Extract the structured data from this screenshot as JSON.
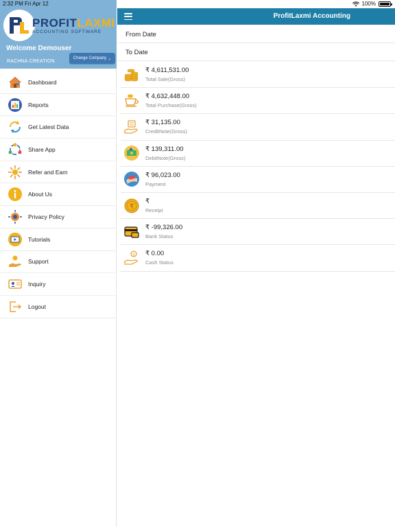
{
  "status_bar": {
    "time": "2:32 PM",
    "date": "Fri Apr 12",
    "battery": "100%"
  },
  "sidebar": {
    "logo": {
      "title_part1": "PROFIT",
      "title_part2": "LAXMI",
      "subtitle": "ACCOUNTING SOFTWARE"
    },
    "welcome": "Welcome Demouser",
    "company": "RACHNA CREATION",
    "change_company": "Change Company",
    "items": [
      {
        "label": "Dashboard",
        "icon": "house-icon"
      },
      {
        "label": "Reports",
        "icon": "reports-icon"
      },
      {
        "label": "Get Latest Data",
        "icon": "refresh-icon"
      },
      {
        "label": "Share App",
        "icon": "share-icon"
      },
      {
        "label": "Refer and Earn",
        "icon": "refer-icon"
      },
      {
        "label": "About Us",
        "icon": "info-icon"
      },
      {
        "label": "Privacy Policy",
        "icon": "privacy-icon"
      },
      {
        "label": "Tutorials",
        "icon": "tutorials-icon"
      },
      {
        "label": "Support",
        "icon": "support-icon"
      },
      {
        "label": "Inquiry",
        "icon": "inquiry-icon"
      },
      {
        "label": "Logout",
        "icon": "logout-icon"
      }
    ]
  },
  "header": {
    "title": "ProfitLaxmi Accounting"
  },
  "filters": {
    "from_date": "From Date",
    "to_date": "To Date"
  },
  "summary": [
    {
      "amount": "₹ 4,611,531.00",
      "label": "Total Sale(Gross)",
      "icon": "coins-stack-icon"
    },
    {
      "amount": "₹ 4,632,448.00",
      "label": "Total Purchase(Gross)",
      "icon": "purchase-icon"
    },
    {
      "amount": "₹ 31,135.00",
      "label": "CreditNote(Gross)",
      "icon": "credit-note-icon"
    },
    {
      "amount": "₹ 139,311.00",
      "label": "DebitNote(Gross)",
      "icon": "debit-note-icon"
    },
    {
      "amount": "₹ 96,023.00",
      "label": "Payment",
      "icon": "payment-icon"
    },
    {
      "amount": "₹",
      "label": "Receipt",
      "icon": "receipt-icon"
    },
    {
      "amount": "₹ -99,326.00",
      "label": "Bank Status",
      "icon": "bank-card-icon"
    },
    {
      "amount": "₹ 0.00",
      "label": "Cash Status",
      "icon": "cash-hand-icon"
    }
  ],
  "colors": {
    "header": "#1f7ea7",
    "sidebar_header": "#7fb2d6",
    "button": "#3f77b3",
    "accent": "#f2b21b",
    "brand_dark": "#1f3e74"
  }
}
